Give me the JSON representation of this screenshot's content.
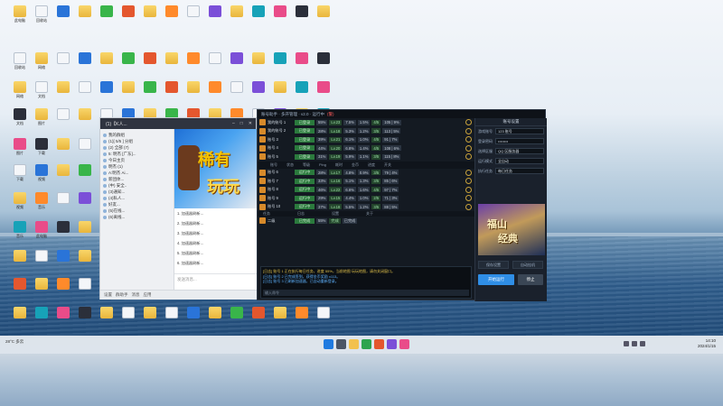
{
  "chat": {
    "title": "(1)【K人...",
    "groups": [
      "我的群组",
      "(1)[ 5/5 ] 分组",
      "(2) 全部 (7)",
      "5: 明杰 [广东]...",
      "今日主页",
      "明杰 (1)",
      "A:明杰 Ai...",
      "新团体...",
      "(中) 安全..",
      "(3)通知...",
      "(4)私人...",
      "好友...",
      "(5)在线...",
      "(6)离线..."
    ],
    "messages": [
      "1.  加速器刷新...",
      "2.  加速器刷新...",
      "3.  加速器刷新...",
      "4.  加速器刷新...",
      "5.  加速器刷新...",
      "6.  加速器刷新..."
    ],
    "input_placeholder": "发送消息...",
    "bottom": [
      "设置",
      "群助手",
      "消息",
      "应用"
    ]
  },
  "banner": {
    "line1": "稀有",
    "line2": "玩玩"
  },
  "tool": {
    "title": "账号助手 · 多开管理 · v2.0 · 运行中",
    "warn": "(警)",
    "columns": [
      "账号",
      "状态",
      "等级",
      "Ping",
      "耗时",
      "金币",
      "进度",
      "开关"
    ],
    "accounts_top": [
      {
        "name": "我的账号 1",
        "status": "已登录",
        "c1": "55%",
        "c2": "Lv.23",
        "c3": "7.5%",
        "c4": "1.5%",
        "c5": "4/5",
        "c6": "105 | 9%"
      },
      {
        "name": "我的账号 2",
        "status": "已登录",
        "c1": "28%",
        "c2": "Lv.18",
        "c3": "5.3%",
        "c4": "1.2%",
        "c5": "3/5",
        "c6": "113 | 5%"
      },
      {
        "name": "账号 3",
        "status": "已登录",
        "c1": "39%",
        "c2": "Lv.21",
        "c3": "6.1%",
        "c4": "1.0%",
        "c5": "4/5",
        "c6": "91 | 7%"
      },
      {
        "name": "账号 4",
        "status": "已登录",
        "c1": "44%",
        "c2": "Lv.20",
        "c3": "6.8%",
        "c4": "1.4%",
        "c5": "4/5",
        "c6": "108 | 6%"
      },
      {
        "name": "账号 5",
        "status": "已登录",
        "c1": "31%",
        "c2": "Lv.19",
        "c3": "5.9%",
        "c4": "1.1%",
        "c5": "3/5",
        "c6": "115 | 8%"
      }
    ],
    "section_labels": [
      "角色",
      "状态",
      "等级",
      "进度"
    ],
    "accounts_bottom": [
      {
        "name": "账号 6",
        "status": "运行中",
        "c1": "28%",
        "c2": "Lv.17",
        "c3": "4.8%",
        "c4": "0.9%",
        "c5": "3/5",
        "c6": "79 | 4%"
      },
      {
        "name": "账号 7",
        "status": "运行中",
        "c1": "33%",
        "c2": "Lv.16",
        "c3": "5.1%",
        "c4": "1.3%",
        "c5": "3/5",
        "c6": "85 | 6%"
      },
      {
        "name": "账号 8",
        "status": "运行中",
        "c1": "46%",
        "c2": "Lv.22",
        "c3": "6.6%",
        "c4": "1.6%",
        "c5": "4/5",
        "c6": "97 | 7%"
      },
      {
        "name": "账号 9",
        "status": "运行中",
        "c1": "29%",
        "c2": "Lv.15",
        "c3": "4.4%",
        "c4": "1.0%",
        "c5": "2/5",
        "c6": "71 | 3%"
      },
      {
        "name": "账号 10",
        "status": "运行中",
        "c1": "37%",
        "c2": "Lv.18",
        "c3": "5.5%",
        "c4": "1.2%",
        "c5": "3/5",
        "c6": "88 | 5%"
      }
    ],
    "footer_labels": [
      "任务",
      "日志",
      "设置",
      "关于"
    ],
    "footer_row": {
      "name": "二级",
      "status": "已完成",
      "c1": "55%",
      "c2": "完成",
      "c3": "已完成"
    },
    "log": [
      "[日志] 账号 1 正在执行每日任务，进度 55%，当前地图 玩玩地图，请勿关闭窗口。",
      "[日志] 账号 2 已完成签到，获得金币奖励 x113。",
      "[日志] 账号 3 已刷新加速器，已自动重新登录。"
    ],
    "log_input_placeholder": "输入命令"
  },
  "side": {
    "title": "账号设置",
    "fields": [
      {
        "label": "游戏账号",
        "value": "123 账号"
      },
      {
        "label": "登录密码",
        "value": "••••••••"
      },
      {
        "label": "选择区服",
        "value": "QQ 区服务器"
      },
      {
        "label": "运行模式",
        "value": "全自动"
      },
      {
        "label": "执行任务",
        "value": "每日任务"
      }
    ],
    "banner": {
      "line1": "福山",
      "line2": "经典"
    },
    "mini": [
      "保存设置",
      "自动挂机"
    ],
    "primary_button": "开始运行",
    "secondary_button": "停止"
  },
  "desktop_labels": [
    "此电脑",
    "回收站",
    "网络",
    "文档",
    "图片",
    "下载",
    "视频",
    "音乐"
  ],
  "taskbar": {
    "weather": "28°C 多云",
    "time": "14:10",
    "date": "2024/1/15"
  }
}
